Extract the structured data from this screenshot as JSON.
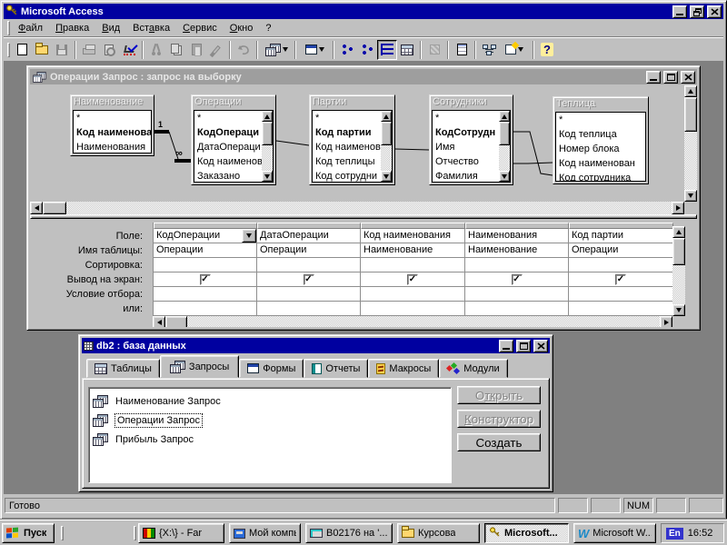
{
  "app": {
    "title": "Microsoft Access"
  },
  "menu": {
    "items": [
      {
        "pre": "",
        "u": "Ф",
        "post": "айл"
      },
      {
        "pre": "",
        "u": "П",
        "post": "равка"
      },
      {
        "pre": "",
        "u": "В",
        "post": "ид"
      },
      {
        "pre": "Вст",
        "u": "а",
        "post": "вка"
      },
      {
        "pre": "",
        "u": "С",
        "post": "ервис"
      },
      {
        "pre": "",
        "u": "О",
        "post": "кно"
      },
      {
        "pre": "?",
        "u": "",
        "post": ""
      }
    ]
  },
  "query_window": {
    "title": "Операции Запрос : запрос на выборку",
    "tables": [
      {
        "name": "Наименование",
        "fields": [
          "*",
          "Код наименован",
          "Наименования"
        ]
      },
      {
        "name": "Операции",
        "fields": [
          "*",
          "КодОпераци",
          "ДатаОпераци",
          "Код наименов",
          "Заказано"
        ]
      },
      {
        "name": "Партии",
        "fields": [
          "*",
          "Код партии",
          "Код наименов",
          "Код теплицы",
          "Код сотрудни"
        ]
      },
      {
        "name": "Сотрудники",
        "fields": [
          "*",
          "КодСотрудн",
          "Имя",
          "Отчество",
          "Фамилия"
        ]
      },
      {
        "name": "Теплица",
        "fields": [
          "*",
          "Код теплица",
          "Номер блока",
          "Код наименован",
          "Код сотрудника"
        ]
      }
    ],
    "joins": {
      "one": "1",
      "many": "∞"
    },
    "grid": {
      "row_labels": [
        "Поле:",
        "Имя таблицы:",
        "Сортировка:",
        "Вывод на экран:",
        "Условие отбора:",
        "или:"
      ],
      "columns": [
        {
          "field": "КодОперации",
          "table": "Операции"
        },
        {
          "field": "ДатаОперации",
          "table": "Операции"
        },
        {
          "field": "Код наименования",
          "table": "Наименование"
        },
        {
          "field": "Наименования",
          "table": "Наименование"
        },
        {
          "field": "Код партии",
          "table": "Операции"
        }
      ],
      "check": "✓"
    }
  },
  "db_window": {
    "title": "db2 : база данных",
    "tabs": [
      "Таблицы",
      "Запросы",
      "Формы",
      "Отчеты",
      "Макросы",
      "Модули"
    ],
    "items": [
      "Наименование Запрос",
      "Операции Запрос",
      "Прибыль Запрос"
    ],
    "buttons": {
      "open": {
        "pre": "О",
        "u": "тк",
        "post": "рыть"
      },
      "design": {
        "pre": "",
        "u": "К",
        "post": "онструктор"
      },
      "create": {
        "pre": "Соз",
        "u": "д",
        "post": "ать"
      }
    }
  },
  "statusbar": {
    "message": "Готово",
    "num": "NUM"
  },
  "taskbar": {
    "start": "Пуск",
    "buttons": [
      "{X:\\} - Far",
      "Мой компь...",
      "B02176 на '...",
      "Курсова",
      "Microsoft...",
      "Microsoft W..."
    ],
    "tray": {
      "lang": "En",
      "clock": "16:52"
    }
  },
  "icons": {
    "help": "?",
    "word_w": "W"
  }
}
